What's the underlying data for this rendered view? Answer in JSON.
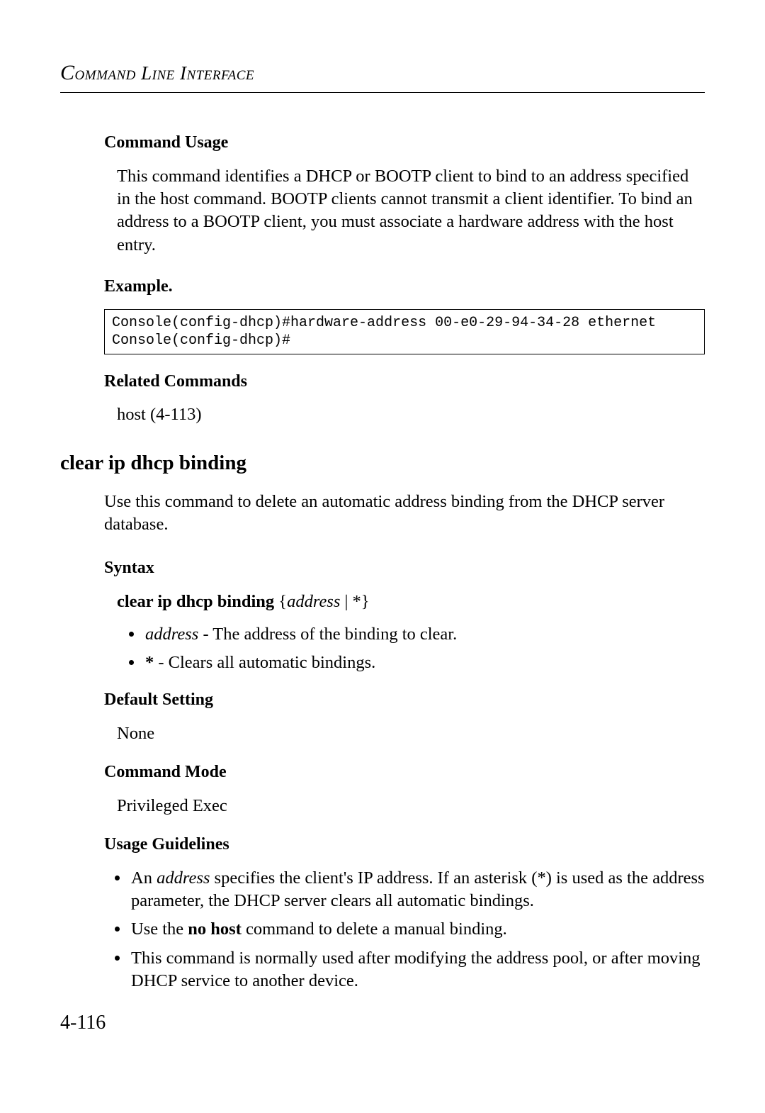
{
  "header": {
    "running_title": "Command Line Interface"
  },
  "sections": {
    "command_usage": {
      "heading": "Command Usage",
      "body": "This command identifies a DHCP or BOOTP client to bind to an address specified in the host command. BOOTP clients cannot transmit a client identifier. To bind an address to a BOOTP client, you must associate a hardware address with the host entry."
    },
    "example": {
      "heading": "Example.",
      "code": "Console(config-dhcp)#hardware-address 00-e0-29-94-34-28 ethernet\nConsole(config-dhcp)#"
    },
    "related_commands": {
      "heading": "Related Commands",
      "body": "host (4-113)"
    },
    "command_title": "clear ip dhcp binding",
    "intro": "Use this command to delete an automatic address binding from the DHCP server database.",
    "syntax": {
      "heading": "Syntax",
      "command_bold": "clear ip dhcp binding",
      "command_args_pre": " {",
      "command_args_em": "address",
      "command_args_post": " | *}",
      "bullets": [
        {
          "em": "address",
          "rest": " - The address of the binding to clear."
        },
        {
          "bold": "*",
          "rest": " - Clears all automatic bindings."
        }
      ]
    },
    "default_setting": {
      "heading": "Default Setting",
      "body": "None"
    },
    "command_mode": {
      "heading": "Command Mode",
      "body": "Privileged Exec"
    },
    "usage_guidelines": {
      "heading": "Usage Guidelines",
      "bullets": [
        {
          "pre": "An ",
          "em": "address",
          "post": " specifies the client's IP address. If an asterisk (*) is used as the address parameter, the DHCP server clears all automatic bindings."
        },
        {
          "pre": "Use the ",
          "bold": "no host",
          "post": " command to delete a manual binding."
        },
        {
          "pre": "This command is normally used after modifying the address pool, or after moving DHCP service to another device.",
          "bold": "",
          "post": ""
        }
      ]
    }
  },
  "page_number": "4-116"
}
